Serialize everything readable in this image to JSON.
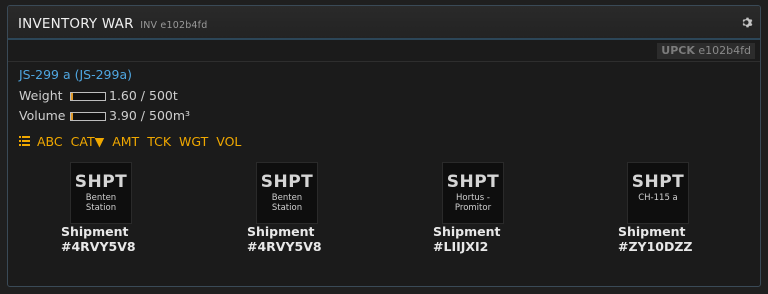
{
  "window": {
    "title": "INVENTORY WAR",
    "title_sub": "INV e102b4fd",
    "gear_icon": "gear-icon"
  },
  "upck": {
    "label": "UPCK",
    "id": "e102b4fd"
  },
  "ship": {
    "name": "JS-299 a (JS-299a)",
    "weight": {
      "label": "Weight",
      "value": "1.60 / 500t",
      "fill": 0.0032
    },
    "volume": {
      "label": "Volume",
      "value": "3.90 / 500m³",
      "fill": 0.0078
    }
  },
  "sort": {
    "icon": "list-icon",
    "options": [
      "ABC",
      "CAT▼",
      "AMT",
      "TCK",
      "WGT",
      "VOL"
    ]
  },
  "items": [
    {
      "ticker": "SHPT",
      "sub": "Benten Station",
      "name_line1": "Shipment",
      "name_line2": "#4RVY5V8"
    },
    {
      "ticker": "SHPT",
      "sub": "Benten Station",
      "name_line1": "Shipment",
      "name_line2": "#4RVY5V8"
    },
    {
      "ticker": "SHPT",
      "sub": "Hortus - Promitor",
      "name_line1": "Shipment",
      "name_line2": "#LIIJXI2"
    },
    {
      "ticker": "SHPT",
      "sub": "CH-115 a",
      "name_line1": "Shipment",
      "name_line2": "#ZY10DZZ"
    }
  ],
  "colors": {
    "accent": "#f0a800",
    "link": "#4fa6e0",
    "bar_fill": "#e09a2a"
  }
}
